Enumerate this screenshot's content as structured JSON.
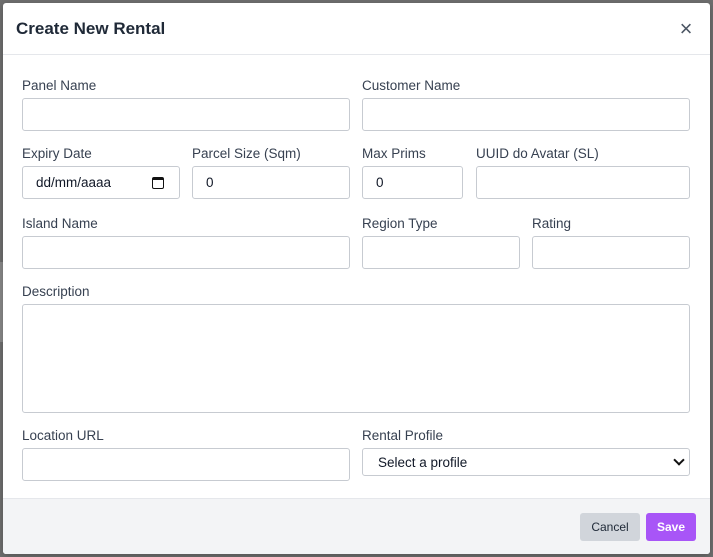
{
  "modal": {
    "title": "Create New Rental",
    "close_symbol": "×"
  },
  "form": {
    "panel_name": {
      "label": "Panel Name",
      "value": ""
    },
    "customer_name": {
      "label": "Customer Name",
      "value": ""
    },
    "expiry_date": {
      "label": "Expiry Date",
      "value": "dd/mm/aaaa"
    },
    "parcel_size": {
      "label": "Parcel Size (Sqm)",
      "value": "0"
    },
    "max_prims": {
      "label": "Max Prims",
      "value": "0"
    },
    "uuid_avatar": {
      "label": "UUID do Avatar (SL)",
      "value": ""
    },
    "island_name": {
      "label": "Island Name",
      "value": ""
    },
    "region_type": {
      "label": "Region Type",
      "value": ""
    },
    "rating": {
      "label": "Rating",
      "value": ""
    },
    "description": {
      "label": "Description",
      "value": ""
    },
    "location_url": {
      "label": "Location URL",
      "value": ""
    },
    "rental_profile": {
      "label": "Rental Profile",
      "value": "Select a profile"
    }
  },
  "footer": {
    "cancel_label": "Cancel",
    "save_label": "Save"
  },
  "colors": {
    "accent": "#a855f7",
    "cancel_bg": "#d1d5db"
  },
  "icons": {
    "close": "close-icon",
    "calendar": "calendar-icon",
    "select": "chevron-down-icon"
  }
}
